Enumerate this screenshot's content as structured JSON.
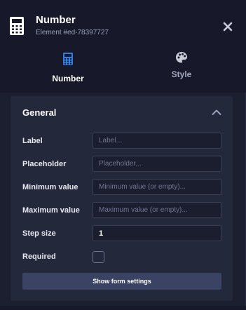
{
  "header": {
    "title": "Number",
    "subtitle": "Element #ed-78397727",
    "icon": "calculator-icon",
    "close_icon": "close-icon"
  },
  "tabs": [
    {
      "label": "Number",
      "icon": "calculator-icon",
      "active": true
    },
    {
      "label": "Style",
      "icon": "palette-icon",
      "active": false
    }
  ],
  "section": {
    "title": "General",
    "expanded": true,
    "chevron_icon": "chevron-up-icon"
  },
  "fields": {
    "label": {
      "label": "Label",
      "value": "",
      "placeholder": "Label..."
    },
    "placeholder": {
      "label": "Placeholder",
      "value": "",
      "placeholder": "Placeholder..."
    },
    "minimum": {
      "label": "Minimum value",
      "value": "",
      "placeholder": "Minimum value (or empty)..."
    },
    "maximum": {
      "label": "Maximum value",
      "value": "",
      "placeholder": "Maximum value (or empty)..."
    },
    "step": {
      "label": "Step size",
      "value": "1",
      "placeholder": ""
    },
    "required": {
      "label": "Required",
      "checked": false
    }
  },
  "actions": {
    "show_form_settings": "Show form settings"
  },
  "colors": {
    "background": "#1c1f30",
    "header": "#17192a",
    "card": "#24283b",
    "accent": "#2f7ee0",
    "button": "#3a4363"
  }
}
